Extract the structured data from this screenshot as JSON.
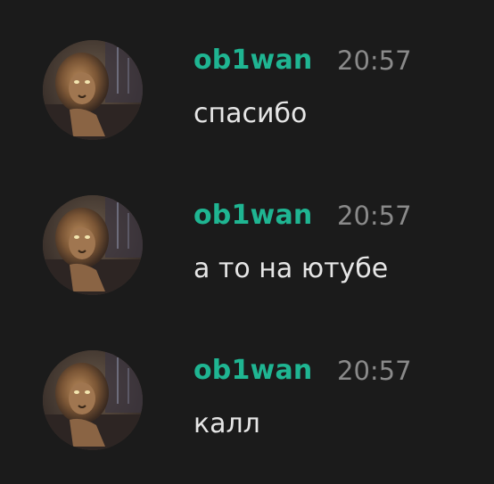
{
  "messages": [
    {
      "author": "ob1wan",
      "time": "20:57",
      "text": "спасибо"
    },
    {
      "author": "ob1wan",
      "time": "20:57",
      "text": "а то на ютубе"
    },
    {
      "author": "ob1wan",
      "time": "20:57",
      "text": "калл"
    }
  ],
  "colors": {
    "background": "#1b1b1b",
    "author": "#1fb592",
    "timestamp": "#8a8a8a",
    "message_text": "#e6e6e6"
  },
  "avatar_icon": "lion-avatar"
}
